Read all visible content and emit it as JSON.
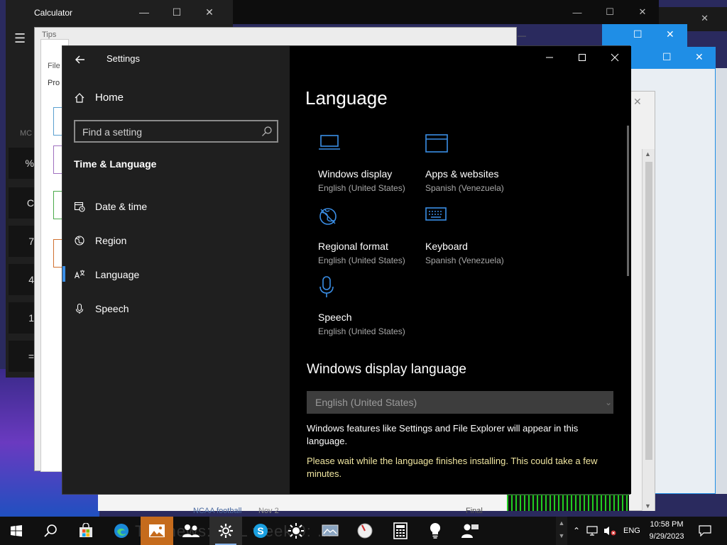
{
  "calculator": {
    "title": "Calculator",
    "mc": "MC",
    "keys": [
      "%",
      "C",
      "7",
      "4",
      "1",
      "="
    ]
  },
  "tips": {
    "title": "Tips",
    "file_menu": "File",
    "pro_label": "Pro"
  },
  "settings": {
    "title": "Settings",
    "home": "Home",
    "search_placeholder": "Find a setting",
    "section": "Time & Language",
    "nav": [
      {
        "label": "Date & time",
        "icon": "date-time-icon"
      },
      {
        "label": "Region",
        "icon": "region-icon"
      },
      {
        "label": "Language",
        "icon": "language-icon",
        "active": true
      },
      {
        "label": "Speech",
        "icon": "microphone-icon"
      }
    ],
    "page_title": "Language",
    "tiles": [
      {
        "label": "Windows display",
        "sub": "English (United States)",
        "icon": "laptop-icon"
      },
      {
        "label": "Apps & websites",
        "sub": "Spanish (Venezuela)",
        "icon": "window-icon"
      },
      {
        "label": "Regional format",
        "sub": "English (United States)",
        "icon": "globe-icon"
      },
      {
        "label": "Keyboard",
        "sub": "Spanish (Venezuela)",
        "icon": "keyboard-icon"
      },
      {
        "label": "Speech",
        "sub": "English (United States)",
        "icon": "microphone-icon"
      }
    ],
    "display_language_heading": "Windows display language",
    "display_language_value": "English (United States)",
    "description": "Windows features like Settings and File Explorer will appear in this language.",
    "warning": "Please wait while the language finishes installing. This could take a few minutes.",
    "accent_color": "#3a8ee6",
    "warning_color": "#f0e6a0"
  },
  "news": {
    "item1": "NCAA football",
    "item2": "Nov 2",
    "item3": "Final"
  },
  "taskbar": {
    "ticker": "Top news: NFL week 9: …",
    "tray_language": "ENG",
    "time": "10:58 PM",
    "date": "9/29/2023"
  }
}
